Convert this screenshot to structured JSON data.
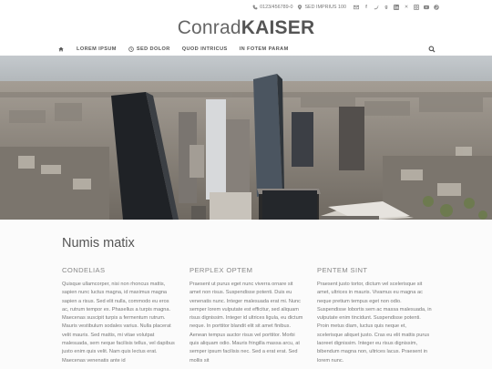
{
  "topbar": {
    "phone": "0123/456789-0",
    "address": "SED IMPRIUS 100",
    "social_icons": [
      "mail-icon",
      "facebook-icon",
      "twitter-icon",
      "google-plus-icon",
      "linkedin-icon",
      "xing-icon",
      "instagram-icon",
      "youtube-icon",
      "pinterest-icon"
    ]
  },
  "logo": {
    "light": "Conrad",
    "bold": "KAISER"
  },
  "nav": {
    "items": [
      {
        "label": "LOREM IPSUM"
      },
      {
        "label": "SED DOLOR"
      },
      {
        "label": "QUOD INTRICUS"
      },
      {
        "label": "IN FOTEM PARAM"
      }
    ]
  },
  "main": {
    "headline": "Numis matix",
    "columns": [
      {
        "title": "CONDELIAS",
        "text": "Quisque ullamcorper, nisi non rhoncus mattis, sapien nunc luctus magna, id maximus magna sapien a risus. Sed elit nulla, commodo eu eros ac, rutrum tempor ex. Phasellus a turpis magna. Maecenas suscipit turpis a fermentum rutrum. Mauris vestibulum sodales varius. Nulla placerat velit mauris. Sed mattis, mi vitae volutpat malesuada, sem neque facilisis tellus, vel dapibus justo enim quis velit. Nam quis lectus erat. Maecenas venenatis ante id"
      },
      {
        "title": "PERPLEX OPTEM",
        "text": "Praesent ut purus eget nunc viverra ornare sit amet non risus. Suspendisse potenti. Duis eu venenatis nunc. Integer malesuada erat mi. Nunc semper lorem vulputate est efficitur, sed aliquam risus dignissim. Integer id ultrices ligula, eu dictum neque. In porttitor blandit elit sit amet finibus. Aenean tempus auctor risus vel porttitor. Morbi quis aliquam odio. Mauris fringilla massa arcu, at semper ipsum facilisis nec. Sed a erat erat. Sed mollis sit"
      },
      {
        "title": "PENTEM SINT",
        "text": "Praesent justo tortor, dictum vel scelerisque sit amet, ultrices in mauris. Vivamus eu magna ac neque pretium tempus eget non odio. Suspendisse lobortis sem ac massa malesuada, in vulputate enim tincidunt. Suspendisse potenti. Proin metus diam, luctus quis neque et, scelerisque aliquet justo. Cras eu elit mattis purus laoreet dignissim. Integer eu risus dignissim, bibendum magna non, ultrices lacus. Praesent in lorem nunc."
      }
    ]
  }
}
